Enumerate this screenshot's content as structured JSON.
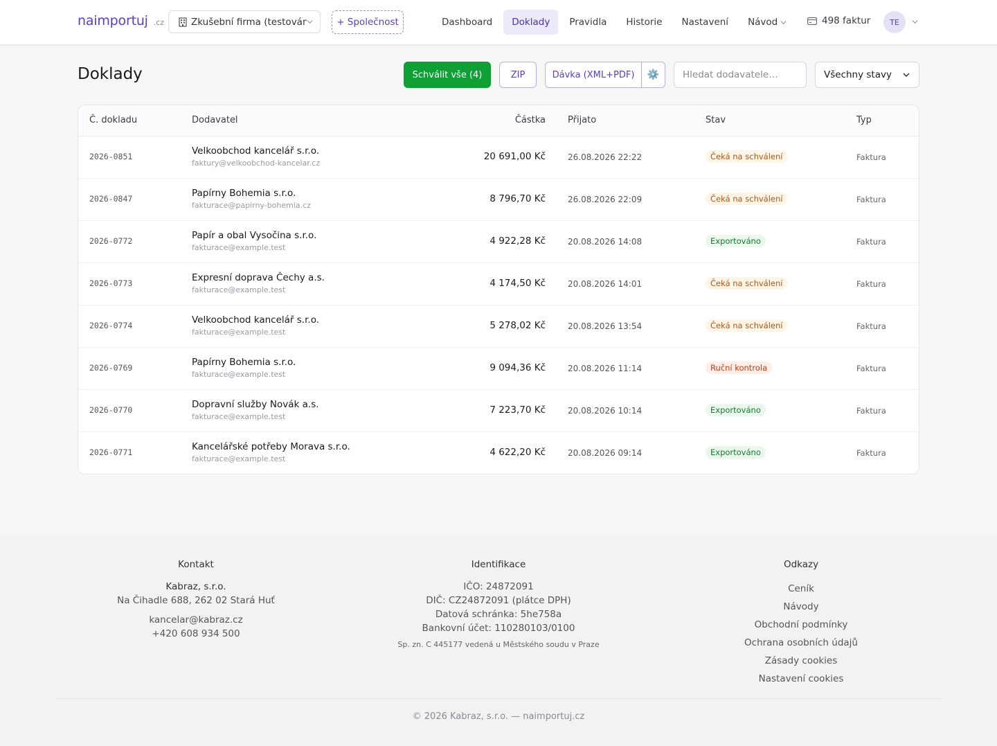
{
  "header": {
    "brand": "naimportuj",
    "brand_tld": ".cz",
    "company": "Zkušební firma (testování)",
    "add_company": "+ Společnost",
    "nav": [
      "Dashboard",
      "Doklady",
      "Pravidla",
      "Historie",
      "Nastavení",
      "Návod"
    ],
    "active_nav": "Doklady",
    "invoice_count": "498 faktur",
    "avatar": "TE"
  },
  "toolbar": {
    "title": "Doklady",
    "approve_all": "Schválit vše (4)",
    "zip": " ZIP",
    "batch": " Dávka (XML+PDF)",
    "gear": "⚙️",
    "search_placeholder": "Hledat dodavatele…",
    "status_filter": "Všechny stavy"
  },
  "table": {
    "columns": [
      "Č. dokladu",
      "Dodavatel",
      "Částka",
      "Přijato",
      "Stav",
      "Typ"
    ],
    "rows": [
      {
        "doc": "2026-0851",
        "supplier": "Velkoobchod kancelář s.r.o.",
        "email": "faktury@velkoobchod-kancelar.cz",
        "amount": "20 691,00 Kč",
        "received": "26.08.2026 22:22",
        "status": "Čeká na schválení",
        "status_kind": "pending",
        "type": "Faktura"
      },
      {
        "doc": "2026-0847",
        "supplier": "Papírny Bohemia s.r.o.",
        "email": "fakturace@papirny-bohemia.cz",
        "amount": "8 796,70 Kč",
        "received": "26.08.2026 22:09",
        "status": "Čeká na schválení",
        "status_kind": "pending",
        "type": "Faktura"
      },
      {
        "doc": "2026-0772",
        "supplier": "Papír a obal Vysočina s.r.o.",
        "email": "fakturace@example.test",
        "amount": "4 922,28 Kč",
        "received": "20.08.2026 14:08",
        "status": "Exportováno",
        "status_kind": "exported",
        "type": "Faktura"
      },
      {
        "doc": "2026-0773",
        "supplier": "Expresní doprava Čechy a.s.",
        "email": "fakturace@example.test",
        "amount": "4 174,50 Kč",
        "received": "20.08.2026 14:01",
        "status": "Čeká na schválení",
        "status_kind": "pending",
        "type": "Faktura"
      },
      {
        "doc": "2026-0774",
        "supplier": "Velkoobchod kancelář s.r.o.",
        "email": "fakturace@example.test",
        "amount": "5 278,02 Kč",
        "received": "20.08.2026 13:54",
        "status": "Čeká na schválení",
        "status_kind": "pending",
        "type": "Faktura"
      },
      {
        "doc": "2026-0769",
        "supplier": "Papírny Bohemia s.r.o.",
        "email": "fakturace@example.test",
        "amount": "9 094,36 Kč",
        "received": "20.08.2026 11:14",
        "status": "Ruční kontrola",
        "status_kind": "manual",
        "type": "Faktura"
      },
      {
        "doc": "2026-0770",
        "supplier": "Dopravní služby Novák a.s.",
        "email": "fakturace@example.test",
        "amount": "7 223,70 Kč",
        "received": "20.08.2026 10:14",
        "status": "Exportováno",
        "status_kind": "exported",
        "type": "Faktura"
      },
      {
        "doc": "2026-0771",
        "supplier": "Kancelářské potřeby Morava s.r.o.",
        "email": "fakturace@example.test",
        "amount": "4 622,20 Kč",
        "received": "20.08.2026 09:14",
        "status": "Exportováno",
        "status_kind": "exported",
        "type": "Faktura"
      }
    ]
  },
  "footer": {
    "contact": {
      "heading": "Kontakt",
      "company": "Kabraz, s.r.o.",
      "address": "Na Čihadle 688, 262 02 Stará Huť",
      "email": "kancelar@kabraz.cz",
      "phone": "+420 608 934 500"
    },
    "identification": {
      "heading": "Identifikace",
      "ico": "IČO: 24872091",
      "dic": "DIČ: CZ24872091 (plátce DPH)",
      "databox": "Datová schránka: 5he758a",
      "bank": "Bankovní účet: 110280103/0100",
      "registry": "Sp. zn. C 445177 vedená u Městského soudu v Praze"
    },
    "links": {
      "heading": "Odkazy",
      "items": [
        "Ceník",
        "Návody",
        "Obchodní podmínky",
        "Ochrana osobních údajů",
        "Zásady cookies",
        "Nastavení cookies"
      ]
    },
    "copyright": "© 2026 Kabraz, s.r.o. — naimportuj.cz"
  },
  "colors": {
    "brand": "#5b3bd6",
    "approve": "#0e9f35",
    "pending": "#b5551d",
    "exported": "#177a33",
    "manual": "#c23b14"
  },
  "icons": {
    "company": "building-icon",
    "invoices": "credit-card-icon",
    "dropdown": "chevron-down-icon",
    "settings": "gear-icon"
  }
}
